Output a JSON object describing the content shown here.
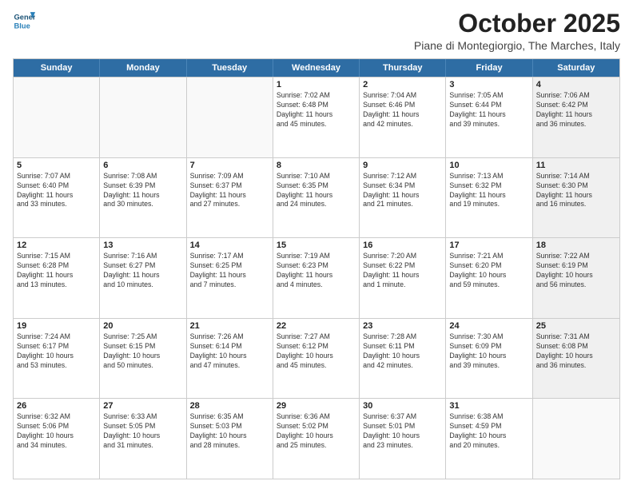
{
  "header": {
    "logo_line1": "General",
    "logo_line2": "Blue",
    "month": "October 2025",
    "location": "Piane di Montegiorgio, The Marches, Italy"
  },
  "weekdays": [
    "Sunday",
    "Monday",
    "Tuesday",
    "Wednesday",
    "Thursday",
    "Friday",
    "Saturday"
  ],
  "rows": [
    [
      {
        "day": "",
        "text": "",
        "empty": true
      },
      {
        "day": "",
        "text": "",
        "empty": true
      },
      {
        "day": "",
        "text": "",
        "empty": true
      },
      {
        "day": "1",
        "text": "Sunrise: 7:02 AM\nSunset: 6:48 PM\nDaylight: 11 hours\nand 45 minutes."
      },
      {
        "day": "2",
        "text": "Sunrise: 7:04 AM\nSunset: 6:46 PM\nDaylight: 11 hours\nand 42 minutes."
      },
      {
        "day": "3",
        "text": "Sunrise: 7:05 AM\nSunset: 6:44 PM\nDaylight: 11 hours\nand 39 minutes."
      },
      {
        "day": "4",
        "text": "Sunrise: 7:06 AM\nSunset: 6:42 PM\nDaylight: 11 hours\nand 36 minutes.",
        "shaded": true
      }
    ],
    [
      {
        "day": "5",
        "text": "Sunrise: 7:07 AM\nSunset: 6:40 PM\nDaylight: 11 hours\nand 33 minutes."
      },
      {
        "day": "6",
        "text": "Sunrise: 7:08 AM\nSunset: 6:39 PM\nDaylight: 11 hours\nand 30 minutes."
      },
      {
        "day": "7",
        "text": "Sunrise: 7:09 AM\nSunset: 6:37 PM\nDaylight: 11 hours\nand 27 minutes."
      },
      {
        "day": "8",
        "text": "Sunrise: 7:10 AM\nSunset: 6:35 PM\nDaylight: 11 hours\nand 24 minutes."
      },
      {
        "day": "9",
        "text": "Sunrise: 7:12 AM\nSunset: 6:34 PM\nDaylight: 11 hours\nand 21 minutes."
      },
      {
        "day": "10",
        "text": "Sunrise: 7:13 AM\nSunset: 6:32 PM\nDaylight: 11 hours\nand 19 minutes."
      },
      {
        "day": "11",
        "text": "Sunrise: 7:14 AM\nSunset: 6:30 PM\nDaylight: 11 hours\nand 16 minutes.",
        "shaded": true
      }
    ],
    [
      {
        "day": "12",
        "text": "Sunrise: 7:15 AM\nSunset: 6:28 PM\nDaylight: 11 hours\nand 13 minutes."
      },
      {
        "day": "13",
        "text": "Sunrise: 7:16 AM\nSunset: 6:27 PM\nDaylight: 11 hours\nand 10 minutes."
      },
      {
        "day": "14",
        "text": "Sunrise: 7:17 AM\nSunset: 6:25 PM\nDaylight: 11 hours\nand 7 minutes."
      },
      {
        "day": "15",
        "text": "Sunrise: 7:19 AM\nSunset: 6:23 PM\nDaylight: 11 hours\nand 4 minutes."
      },
      {
        "day": "16",
        "text": "Sunrise: 7:20 AM\nSunset: 6:22 PM\nDaylight: 11 hours\nand 1 minute."
      },
      {
        "day": "17",
        "text": "Sunrise: 7:21 AM\nSunset: 6:20 PM\nDaylight: 10 hours\nand 59 minutes."
      },
      {
        "day": "18",
        "text": "Sunrise: 7:22 AM\nSunset: 6:19 PM\nDaylight: 10 hours\nand 56 minutes.",
        "shaded": true
      }
    ],
    [
      {
        "day": "19",
        "text": "Sunrise: 7:24 AM\nSunset: 6:17 PM\nDaylight: 10 hours\nand 53 minutes."
      },
      {
        "day": "20",
        "text": "Sunrise: 7:25 AM\nSunset: 6:15 PM\nDaylight: 10 hours\nand 50 minutes."
      },
      {
        "day": "21",
        "text": "Sunrise: 7:26 AM\nSunset: 6:14 PM\nDaylight: 10 hours\nand 47 minutes."
      },
      {
        "day": "22",
        "text": "Sunrise: 7:27 AM\nSunset: 6:12 PM\nDaylight: 10 hours\nand 45 minutes."
      },
      {
        "day": "23",
        "text": "Sunrise: 7:28 AM\nSunset: 6:11 PM\nDaylight: 10 hours\nand 42 minutes."
      },
      {
        "day": "24",
        "text": "Sunrise: 7:30 AM\nSunset: 6:09 PM\nDaylight: 10 hours\nand 39 minutes."
      },
      {
        "day": "25",
        "text": "Sunrise: 7:31 AM\nSunset: 6:08 PM\nDaylight: 10 hours\nand 36 minutes.",
        "shaded": true
      }
    ],
    [
      {
        "day": "26",
        "text": "Sunrise: 6:32 AM\nSunset: 5:06 PM\nDaylight: 10 hours\nand 34 minutes."
      },
      {
        "day": "27",
        "text": "Sunrise: 6:33 AM\nSunset: 5:05 PM\nDaylight: 10 hours\nand 31 minutes."
      },
      {
        "day": "28",
        "text": "Sunrise: 6:35 AM\nSunset: 5:03 PM\nDaylight: 10 hours\nand 28 minutes."
      },
      {
        "day": "29",
        "text": "Sunrise: 6:36 AM\nSunset: 5:02 PM\nDaylight: 10 hours\nand 25 minutes."
      },
      {
        "day": "30",
        "text": "Sunrise: 6:37 AM\nSunset: 5:01 PM\nDaylight: 10 hours\nand 23 minutes."
      },
      {
        "day": "31",
        "text": "Sunrise: 6:38 AM\nSunset: 4:59 PM\nDaylight: 10 hours\nand 20 minutes."
      },
      {
        "day": "",
        "text": "",
        "empty": true
      }
    ]
  ]
}
